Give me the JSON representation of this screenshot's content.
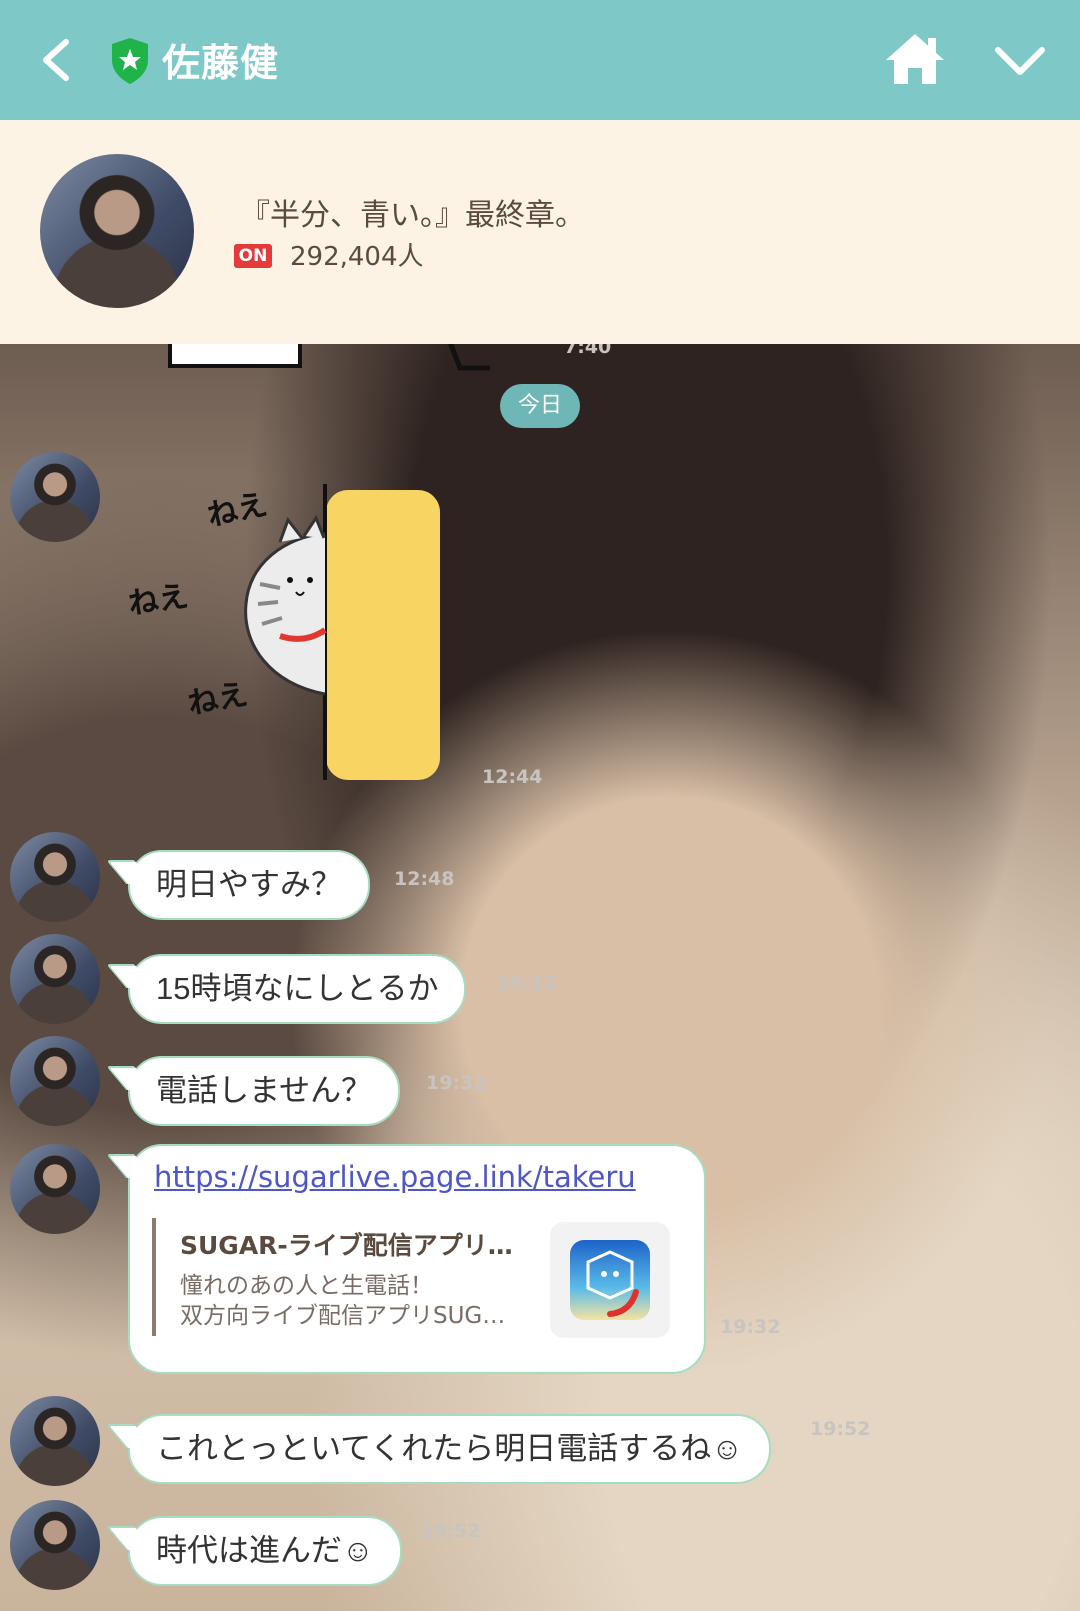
{
  "header": {
    "title": "佐藤健",
    "back_icon": "chevron-left-icon",
    "shield_icon": "verified-shield-icon",
    "home_icon": "home-icon",
    "menu_icon": "chevron-down-icon",
    "bar_color": "#7ec9c8"
  },
  "profile": {
    "status": "『半分、青い。』最終章。",
    "badge": "ON",
    "followers": "292,404人"
  },
  "chat": {
    "top_time": "7:40",
    "date_label": "今日",
    "sticker_time": "12:44",
    "messages": [
      {
        "text": "明日やすみ？",
        "time": "12:48"
      },
      {
        "text": "15時頃なにしとるか",
        "time": "16:12"
      },
      {
        "text": "電話しません？",
        "time": "19:32"
      }
    ],
    "link_message": {
      "url": "https://sugarlive.page.link/takeru",
      "preview_title": "SUGAR-ライブ配信アプリ…",
      "preview_desc1": "憧れのあの人と生電話！",
      "preview_desc2": "双方向ライブ配信アプリSUG…",
      "time": "19:32"
    },
    "messages2": [
      {
        "text": "これとっといてくれたら明日電話するね☺",
        "time": "19:52"
      },
      {
        "text": "時代は進んだ☺",
        "time": "19:52"
      }
    ],
    "bubble_border_color": "#a6dcc0"
  }
}
